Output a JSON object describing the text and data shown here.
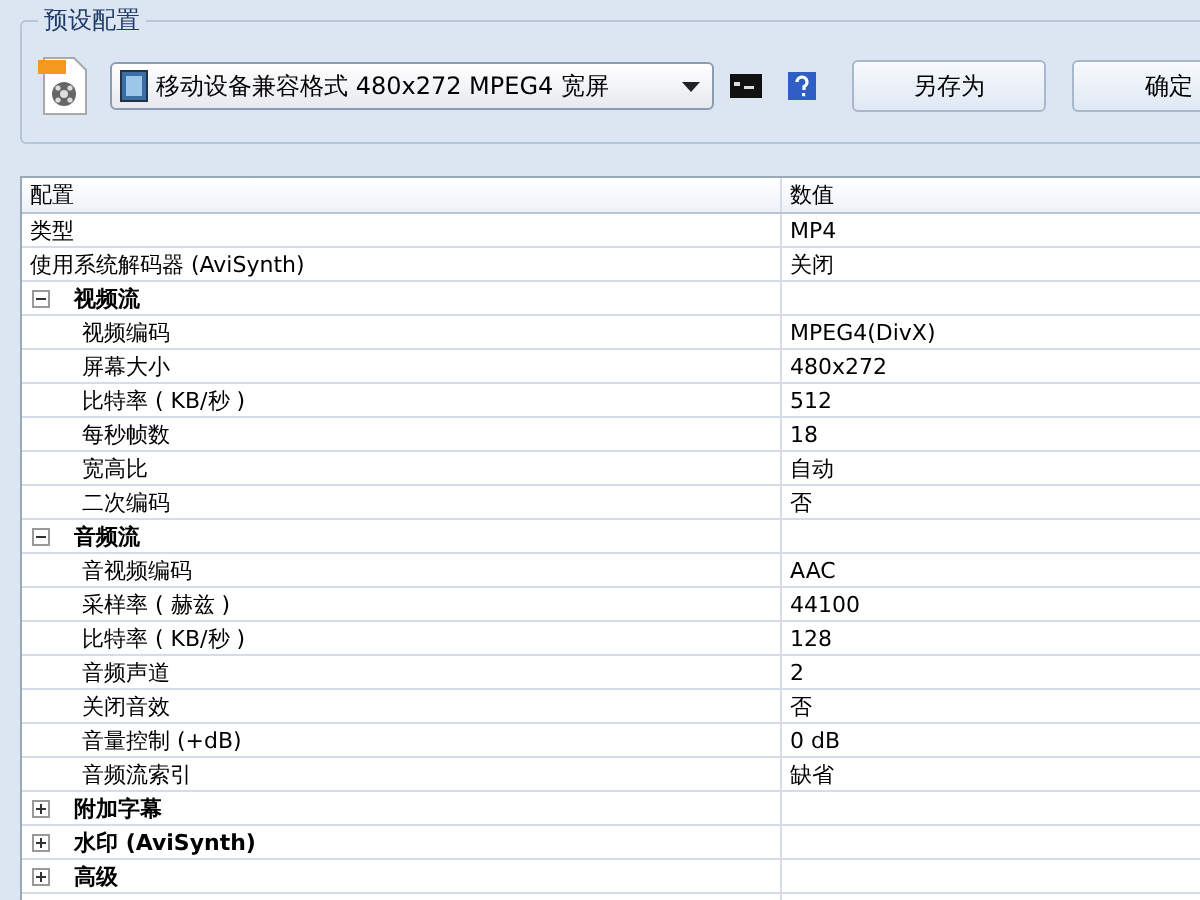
{
  "preset_group": {
    "title": "预设配置",
    "preset_select": {
      "value": "移动设备兼容格式 480x272 MPEG4 宽屏"
    },
    "buttons": [
      {
        "label": "另存为"
      },
      {
        "label": "确定"
      }
    ]
  },
  "table": {
    "columns": [
      "配置",
      "数值"
    ],
    "rows": [
      {
        "kind": "property",
        "name": "类型",
        "value": "MP4"
      },
      {
        "kind": "property",
        "name": "使用系统解码器 (AviSynth)",
        "value": "关闭"
      },
      {
        "kind": "group",
        "name": "视频流",
        "expanded": true,
        "children": [
          {
            "kind": "property",
            "name": "视频编码",
            "value": "MPEG4(DivX)"
          },
          {
            "kind": "property",
            "name": "屏幕大小",
            "value": "480x272"
          },
          {
            "kind": "property",
            "name": "比特率 ( KB/秒 )",
            "value": "512"
          },
          {
            "kind": "property",
            "name": "每秒帧数",
            "value": "18"
          },
          {
            "kind": "property",
            "name": "宽高比",
            "value": "自动"
          },
          {
            "kind": "property",
            "name": "二次编码",
            "value": "否"
          }
        ]
      },
      {
        "kind": "group",
        "name": "音频流",
        "expanded": true,
        "children": [
          {
            "kind": "property",
            "name": "音视频编码",
            "value": "AAC"
          },
          {
            "kind": "property",
            "name": "采样率 ( 赫兹 )",
            "value": "44100"
          },
          {
            "kind": "property",
            "name": "比特率 ( KB/秒 )",
            "value": "128"
          },
          {
            "kind": "property",
            "name": "音频声道",
            "value": "2"
          },
          {
            "kind": "property",
            "name": "关闭音效",
            "value": "否"
          },
          {
            "kind": "property",
            "name": "音量控制 (+dB)",
            "value": "0 dB"
          },
          {
            "kind": "property",
            "name": "音频流索引",
            "value": "缺省"
          }
        ]
      },
      {
        "kind": "group",
        "name": "附加字幕",
        "expanded": false,
        "children": []
      },
      {
        "kind": "group",
        "name": "水印 (AviSynth)",
        "expanded": false,
        "children": []
      },
      {
        "kind": "group",
        "name": "高级",
        "expanded": false,
        "children": []
      }
    ]
  }
}
